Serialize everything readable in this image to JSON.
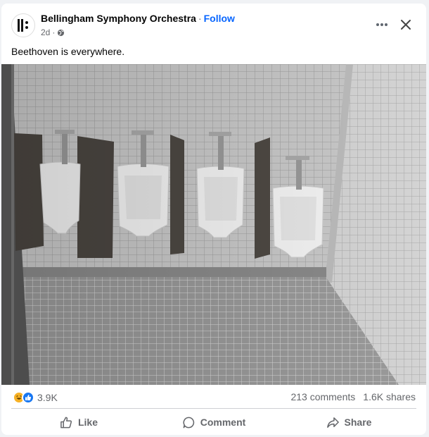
{
  "post": {
    "page_name": "Bellingham Symphony Orchestra",
    "separator": "·",
    "follow_label": "Follow",
    "time_ago": "2d",
    "meta_dot": "·",
    "privacy_icon": "globe-icon",
    "text": "Beethoven is everywhere."
  },
  "header_icons": {
    "more": "more-horizontal-icon",
    "close": "close-icon"
  },
  "stats": {
    "reaction_icons": [
      "haha-reaction-icon",
      "like-reaction-icon"
    ],
    "reaction_count": "3.9K",
    "comments": "213 comments",
    "shares": "1.6K shares"
  },
  "actions": {
    "like": "Like",
    "comment": "Comment",
    "share": "Share"
  },
  "colors": {
    "accent": "#0866ff",
    "secondary_text": "#65676b",
    "haha_yellow": "#f7b125",
    "like_blue": "#1877f2"
  }
}
